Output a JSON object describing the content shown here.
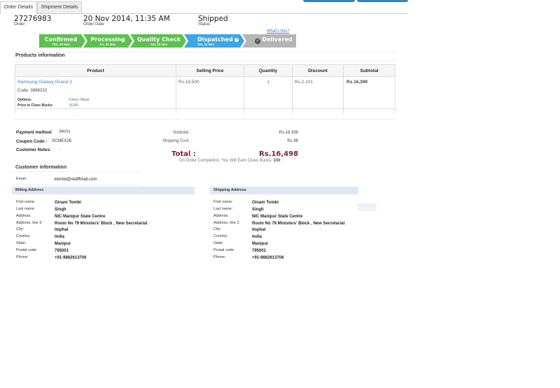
{
  "tabs": [
    "Order Details",
    "Shipment Details"
  ],
  "order": {
    "id": "27276983",
    "id_label": "Order",
    "date": "20 Nov 2014, 11:35 AM",
    "date_label": "Order Date",
    "status": "Shipped",
    "status_label": "Status"
  },
  "progress": {
    "whats_this": "What's this?",
    "steps": [
      {
        "label": "Confirmed",
        "date": "Thu, 20 Nov",
        "color": "#5cc14e"
      },
      {
        "label": "Processing",
        "date": "Fri, 21 Nov",
        "color": "#5cc14e"
      },
      {
        "label": "Quality Check",
        "date": "Sat, 22 Nov",
        "color": "#5cc14e"
      },
      {
        "label": "Dispatched",
        "date": "Sat, 22 Nov",
        "color": "#3ea6e0"
      },
      {
        "label": "Delivered",
        "date": "",
        "color": "#b5b5b5"
      }
    ]
  },
  "products": {
    "title": "Products information",
    "headers": [
      "Product",
      "Selling Price",
      "Quantity",
      "Discount",
      "Subtotal"
    ],
    "item": {
      "name": "Samsung Galaxy Grand 2",
      "code": "Code: 3988222",
      "options_label": "Options:",
      "options_value": "Colors: Black",
      "clues_label": "Price in Clues Bucks:",
      "clues_value": "16399",
      "price": "Rs.18,500",
      "quantity": "1",
      "discount": "Rs.2,101",
      "subtotal": "Rs.16,399"
    }
  },
  "payment": {
    "method_label": "Payment method:",
    "method": "PAYU",
    "coupon_label": "Coupon Code :",
    "coupon": "SCMEX26",
    "notes_label": "Customer Notes:",
    "notes": "-"
  },
  "totals": {
    "subtotal_label": "Subtotal :",
    "subtotal": "Rs.16,399",
    "shipping_label": "Shipping Cost :",
    "shipping": "Rs.99",
    "total_label": "Total :",
    "total": "Rs.16,498",
    "clues_note": "On Order Completion, You Will Earn Clues Bucks:",
    "clues_bucks": "330"
  },
  "customer": {
    "title": "Customer information",
    "email_label": "Email:",
    "email": "otombi@rediffmail.com"
  },
  "address_labels": [
    "First name:",
    "Last name:",
    "Address:",
    "Address, line 2:",
    "City:",
    "Country:",
    "State:",
    "Postal code:",
    "Phone:"
  ],
  "billing": {
    "title": "Billing Address",
    "values": [
      "Oinam Tombi",
      "Singh",
      "NIC Manipur State Centre",
      "Room No 79 Ministers' Block , New Secretariat",
      "Imphal",
      "India",
      "Manipur",
      "795001",
      "+91-9862613706"
    ]
  },
  "shipping": {
    "title": "Shipping Address",
    "values": [
      "Oinam Tombi",
      "Singh",
      "NIC Manipur State Centre",
      "Room No 79 Ministers' Block , New Secretariat",
      "Imphal",
      "India",
      "Manipur",
      "795001",
      "+91-9862613706"
    ]
  }
}
